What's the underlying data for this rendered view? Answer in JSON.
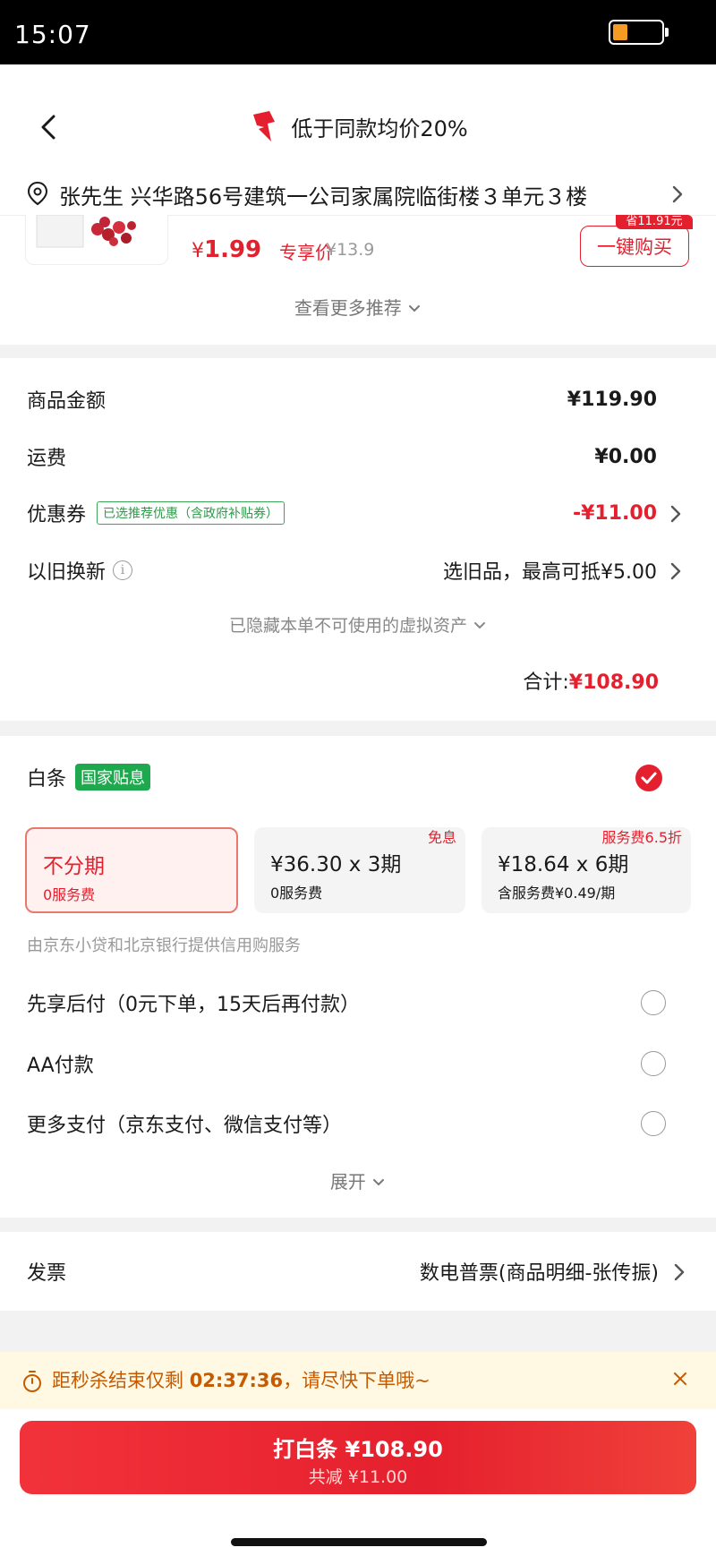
{
  "status_bar": {
    "time": "15:07",
    "battery_level": 0.3
  },
  "header": {
    "title": "低于同款均价20%"
  },
  "address": {
    "text": "张先生 兴华路56号建筑一公司家属院临街楼３单元３楼"
  },
  "recommendation": {
    "price_symbol": "¥",
    "price": "1.99",
    "price_tag": "专享价",
    "original_price": "¥13.9",
    "save_badge": "省11.91元",
    "buy_button": "一键购买",
    "more_label": "查看更多推荐"
  },
  "price_summary": {
    "goods_label": "商品金额",
    "goods_value": "¥119.90",
    "shipping_label": "运费",
    "shipping_value": "¥0.00",
    "coupon_label": "优惠券",
    "coupon_tag": "已选推荐优惠（含政府补贴券）",
    "coupon_value": "-¥11.00",
    "tradein_label": "以旧换新",
    "tradein_value": "选旧品，最高可抵¥5.00",
    "hidden_assets": "已隐藏本单不可使用的虚拟资产",
    "total_label": "合计:",
    "total_value": "¥108.90"
  },
  "payment": {
    "baitiao_label": "白条",
    "baitiao_tag": "国家贴息",
    "plans": [
      {
        "main": "不分期",
        "sub": "0服务费",
        "corner": ""
      },
      {
        "main": "¥36.30 x 3期",
        "sub": "0服务费",
        "corner": "免息"
      },
      {
        "main": "¥18.64 x 6期",
        "sub": "含服务费¥0.49/期",
        "corner": "服务费6.5折"
      }
    ],
    "credit_note": "由京东小贷和北京银行提供信用购服务",
    "options": [
      "先享后付（0元下单，15天后再付款）",
      "AA付款",
      "更多支付（京东支付、微信支付等）"
    ],
    "expand_label": "展开"
  },
  "invoice": {
    "label": "发票",
    "value": "数电普票(商品明细-张传振)"
  },
  "flash": {
    "prefix": "距秒杀结束仅剩 ",
    "time": "02:37:36",
    "suffix": "，请尽快下单哦~"
  },
  "submit": {
    "main": "打白条 ¥108.90",
    "sub": "共减 ¥11.00"
  },
  "colors": {
    "accent": "#e5202e",
    "green": "#1fa94f",
    "warning": "#c65a00"
  }
}
